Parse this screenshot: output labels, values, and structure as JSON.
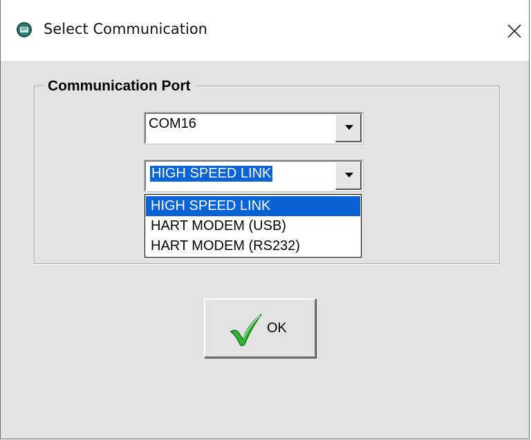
{
  "window": {
    "title": "Select Communication",
    "icon": "app-icon",
    "close_icon": "close-icon"
  },
  "group": {
    "legend": "Communication Port"
  },
  "port_select": {
    "value": "COM16"
  },
  "link_select": {
    "value": "HIGH SPEED LINK",
    "expanded": true,
    "options": [
      "HIGH SPEED LINK",
      "HART MODEM (USB)",
      "HART MODEM (RS232)"
    ],
    "selected_index": 0
  },
  "ok_button": {
    "label": "OK",
    "icon": "checkmark-icon"
  },
  "colors": {
    "selection": "#0a64d8",
    "dialog_bg": "#e3e3e3",
    "check_green": "#2fb82f"
  }
}
